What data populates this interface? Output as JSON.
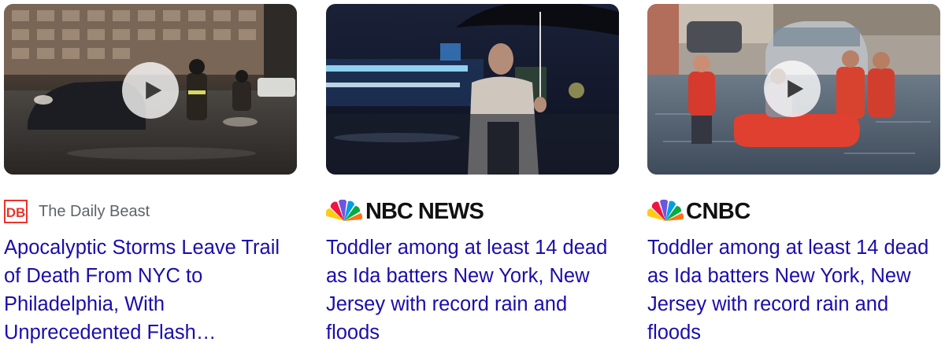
{
  "cards": [
    {
      "source": {
        "name": "The Daily Beast",
        "logo_text": "DB",
        "logo_color": "#e8352b",
        "icon": "daily-beast-logo-icon"
      },
      "headline": "Apocalyptic Storms Leave Trail of Death From NYC to Philadelphia, With Unprecedented Flash…",
      "has_video": true
    },
    {
      "source": {
        "name": "NBC NEWS",
        "icon": "nbc-peacock-logo-icon"
      },
      "headline": "Toddler among at least 14 dead as Ida batters New York, New Jersey with record rain and floods",
      "has_video": false
    },
    {
      "source": {
        "name": "CNBC",
        "icon": "cnbc-peacock-logo-icon"
      },
      "headline": "Toddler among at least 14 dead as Ida batters New York, New Jersey with record rain and floods",
      "has_video": true
    }
  ],
  "colors": {
    "headline_link": "#1a0dab",
    "source_text": "#5f6368",
    "play_button_bg": "rgba(255,255,255,0.78)"
  }
}
